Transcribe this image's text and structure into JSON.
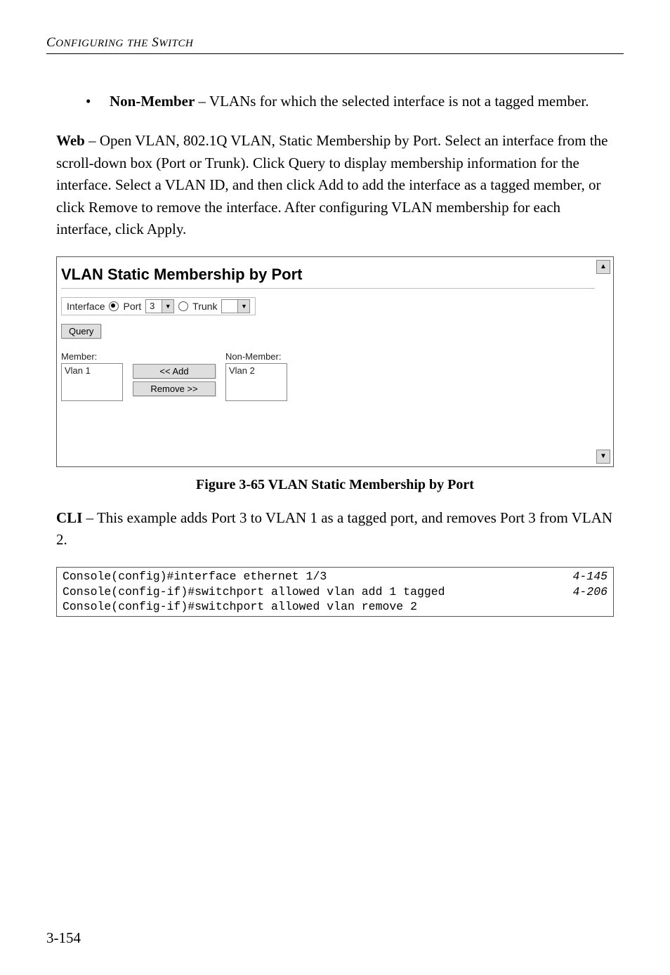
{
  "header": "CONFIGURING THE SWITCH",
  "bullet": {
    "term": "Non-Member",
    "desc": " – VLANs for which the selected interface is not a tagged member."
  },
  "web_para_lead": "Web",
  "web_para": " – Open VLAN, 802.1Q VLAN, Static Membership by Port. Select an interface from the scroll-down box (Port or Trunk). Click Query to display membership information for the interface. Select a VLAN ID, and then click Add to add the interface as a tagged member, or click Remove to remove the interface. After configuring VLAN membership for each interface, click Apply.",
  "panel": {
    "title": "VLAN Static Membership by Port",
    "interface_label": "Interface",
    "port_label": "Port",
    "port_value": "3",
    "trunk_label": "Trunk",
    "trunk_value": "",
    "query_btn": "Query",
    "member_label": "Member:",
    "nonmember_label": "Non-Member:",
    "member_item": "Vlan 1",
    "nonmember_item": "Vlan 2",
    "add_btn": "<< Add",
    "remove_btn": "Remove >>"
  },
  "figure_caption": "Figure 3-65  VLAN Static Membership by Port",
  "cli_lead": "CLI",
  "cli_para": " – This example adds Port 3 to VLAN 1 as a tagged port, and removes Port 3 from VLAN 2.",
  "cli_lines": [
    {
      "cmd": "Console(config)#interface ethernet 1/3",
      "ref": "4-145"
    },
    {
      "cmd": "Console(config-if)#switchport allowed vlan add 1 tagged",
      "ref": "4-206"
    },
    {
      "cmd": "Console(config-if)#switchport allowed vlan remove 2",
      "ref": ""
    }
  ],
  "page_number": "3-154"
}
